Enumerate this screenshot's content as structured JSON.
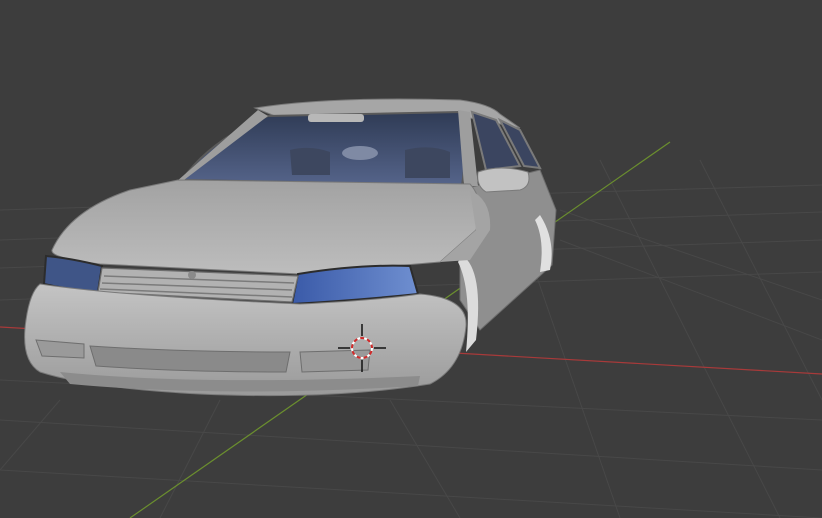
{
  "viewport": {
    "background": "#3d3d3d",
    "grid_color": "#474747",
    "x_axis_color": "#a83a3a",
    "y_axis_color": "#6b8f2e",
    "object": "car-model",
    "object_color": "#9c9c9c",
    "glass_color": "#4a5a78",
    "headlight_color": "#4a6fb5",
    "cursor_icon": "3d-cursor-icon"
  }
}
